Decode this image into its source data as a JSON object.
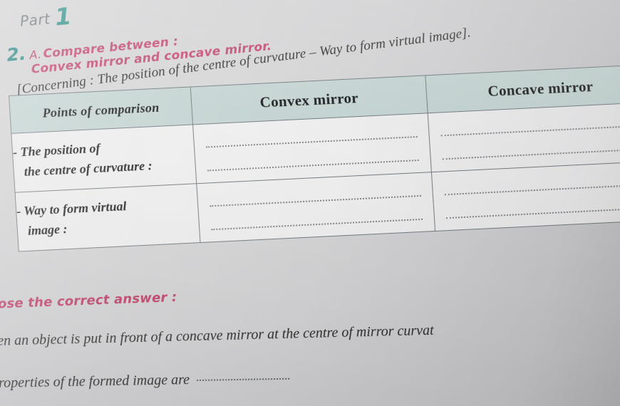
{
  "page": {
    "background_color": "#cfcfd1",
    "paper_note": "photographed workbook page, slight rotation and curvature"
  },
  "header": {
    "part_word": "Part",
    "part_number": "1",
    "part_color": "#2b8c86"
  },
  "question2": {
    "number": "2.",
    "sub_label": "A.",
    "prompt": "Compare between :",
    "subject_line": "Convex mirror and concave mirror.",
    "concerning_line": "[Concerning : The position of the centre of curvature – Way to form virtual image].",
    "accent_color": "#c0436c",
    "number_color": "#27857f"
  },
  "table": {
    "headers": [
      "Points of comparison",
      "Convex mirror",
      "Concave mirror"
    ],
    "header_bg": "#c3d3d1",
    "rows": [
      {
        "label_line1": "- The position of",
        "label_line2": "the centre of curvature :",
        "convex_answer": "",
        "concave_answer": ""
      },
      {
        "label_line1": "- Way to form virtual",
        "label_line2": "image :",
        "convex_answer": "",
        "concave_answer": ""
      }
    ]
  },
  "mcq": {
    "instruction": "oose the correct answer :",
    "line1": "hen an object is put in front of a concave mirror at the centre of mirror curvat",
    "line2": "properties of the formed image are",
    "blank": ""
  }
}
